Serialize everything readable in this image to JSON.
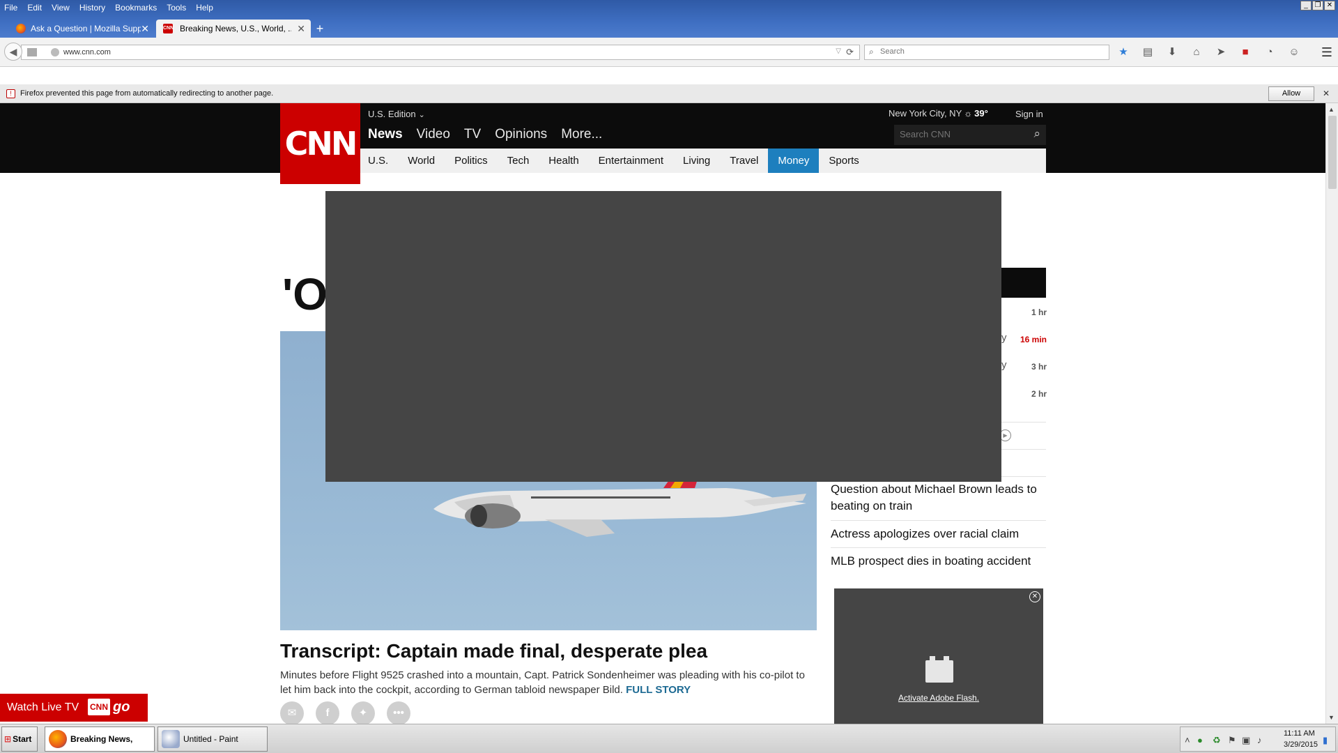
{
  "browser": {
    "menu": [
      "File",
      "Edit",
      "View",
      "History",
      "Bookmarks",
      "Tools",
      "Help"
    ],
    "tabs": [
      {
        "title": "Ask a Question | Mozilla Supp...",
        "close": "✕"
      },
      {
        "title": "Breaking News, U.S., World, ...",
        "close": "✕",
        "favicon": "CNN"
      }
    ],
    "new_tab": "+",
    "url": "www.cnn.com",
    "search_placeholder": "Search",
    "notification": {
      "text": "Firefox prevented this page from automatically redirecting to another page.",
      "allow_label": "Allow",
      "close": "✕"
    },
    "colors": {
      "titlebar": "#3f6fc2",
      "star": "#2e7dd8"
    }
  },
  "cnn": {
    "logo": "CNN",
    "edition": "U.S. Edition",
    "weather_location": "New York City, NY",
    "weather_temp": "39°",
    "signin": "Sign in",
    "primary_nav": [
      "News",
      "Video",
      "TV",
      "Opinions",
      "More..."
    ],
    "search_placeholder": "Search CNN",
    "sections": [
      "U.S.",
      "World",
      "Politics",
      "Tech",
      "Health",
      "Entertainment",
      "Living",
      "Travel",
      "Money",
      "Sports"
    ],
    "active_section": "Money",
    "headline_partial": "'O",
    "story": {
      "title": "Transcript: Captain made final, desperate plea",
      "description": "Minutes before Flight 9525 crashed into a mountain, Capt. Patrick Sondenheimer was pleading with his co-pilot to let him back into the cockpit, according to German tabloid newspaper Bild.",
      "full_story": "FULL STORY"
    },
    "right_times": [
      "1 hr",
      "16 min",
      "3 hr",
      "2 hr"
    ],
    "right_partials": [
      "y",
      "y"
    ],
    "links": [
      "Question about Michael Brown leads to beating on train",
      "Actress apologizes over racial claim",
      "MLB prospect dies in boating accident"
    ],
    "flash": {
      "link": "Activate Adobe Flash.",
      "close": "✕"
    },
    "watch_live": "Watch Live TV",
    "cnngo_badge": "CNN",
    "cnngo_go": "go",
    "brand_color": "#cc0000",
    "money_color": "#1d7fbe"
  },
  "taskbar": {
    "start": "Start",
    "tasks": [
      {
        "label": "Breaking News, U.S..."
      },
      {
        "label": "Untitled - Paint"
      }
    ],
    "time": "11:11 AM",
    "date": "3/29/2015"
  }
}
